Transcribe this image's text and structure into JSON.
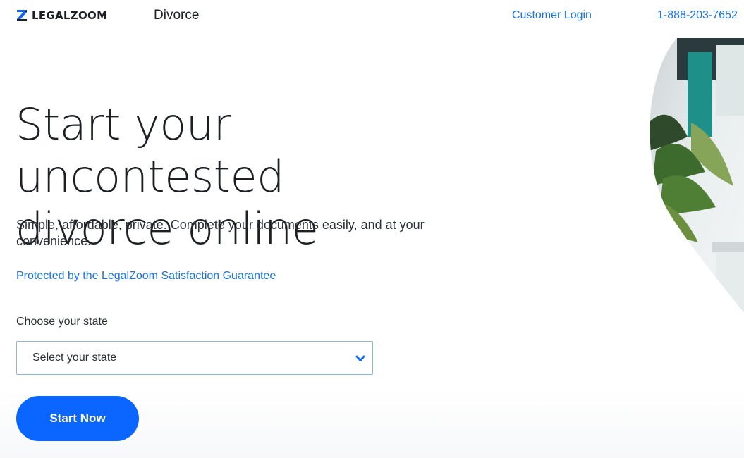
{
  "header": {
    "logo_text": "LEGALZOOM",
    "nav_title": "Divorce",
    "customer_login": "Customer Login",
    "phone": "1-888-203-7652"
  },
  "hero": {
    "headline_line1": "Start your uncontested",
    "headline_line2": "divorce online",
    "subtitle": "Simple, affordable, private. Complete your documents easily, and at your convenience.",
    "guarantee_link": "Protected by the LegalZoom Satisfaction Guarantee"
  },
  "form": {
    "state_label": "Choose your state",
    "state_select_value": "Select your state",
    "start_button": "Start Now"
  },
  "colors": {
    "brand_blue": "#0a66ff",
    "link_blue": "#1a73e8",
    "text_dark": "#1c1f24"
  },
  "icons": {
    "logo": "legalzoom-z-logo-icon",
    "dropdown": "chevron-down-icon"
  }
}
